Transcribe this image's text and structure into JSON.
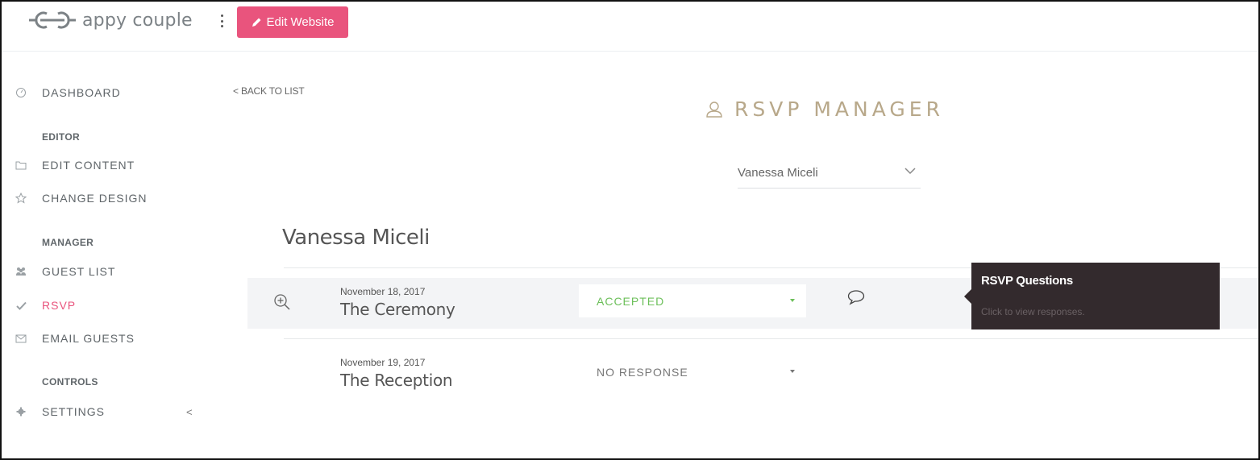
{
  "app": {
    "logo_text": "appy couple"
  },
  "header": {
    "edit_button_label": "Edit Website"
  },
  "sidebar": {
    "items": [
      {
        "label": "DASHBOARD",
        "icon": "dashboard-icon"
      },
      {
        "label": "EDIT CONTENT",
        "icon": "folder-icon"
      },
      {
        "label": "CHANGE DESIGN",
        "icon": "star-icon"
      },
      {
        "label": "GUEST LIST",
        "icon": "users-icon"
      },
      {
        "label": "RSVP",
        "icon": "check-icon"
      },
      {
        "label": "EMAIL GUESTS",
        "icon": "envelope-icon"
      },
      {
        "label": "SETTINGS",
        "icon": "gear-icon"
      }
    ],
    "sections": {
      "editor": "EDITOR",
      "manager": "MANAGER",
      "controls": "CONTROLS"
    },
    "collapse_glyph": "<",
    "active_item": "RSVP"
  },
  "main": {
    "back_link": "< BACK TO LIST",
    "title": "RSVP MANAGER",
    "guest_select": {
      "value": "Vanessa Miceli"
    },
    "guest_name": "Vanessa Miceli",
    "events": [
      {
        "date": "November 18, 2017",
        "name": "The Ceremony",
        "status": "ACCEPTED"
      },
      {
        "date": "November 19, 2017",
        "name": "The Reception",
        "status": "NO RESPONSE"
      }
    ]
  },
  "tooltip": {
    "title": "RSVP Questions",
    "body": "Click to view responses."
  },
  "colors": {
    "brand_pink": "#e9547d",
    "accepted_green": "#6cbf5a",
    "title_gold": "#b8a88a",
    "tooltip_bg": "#332a2d"
  }
}
